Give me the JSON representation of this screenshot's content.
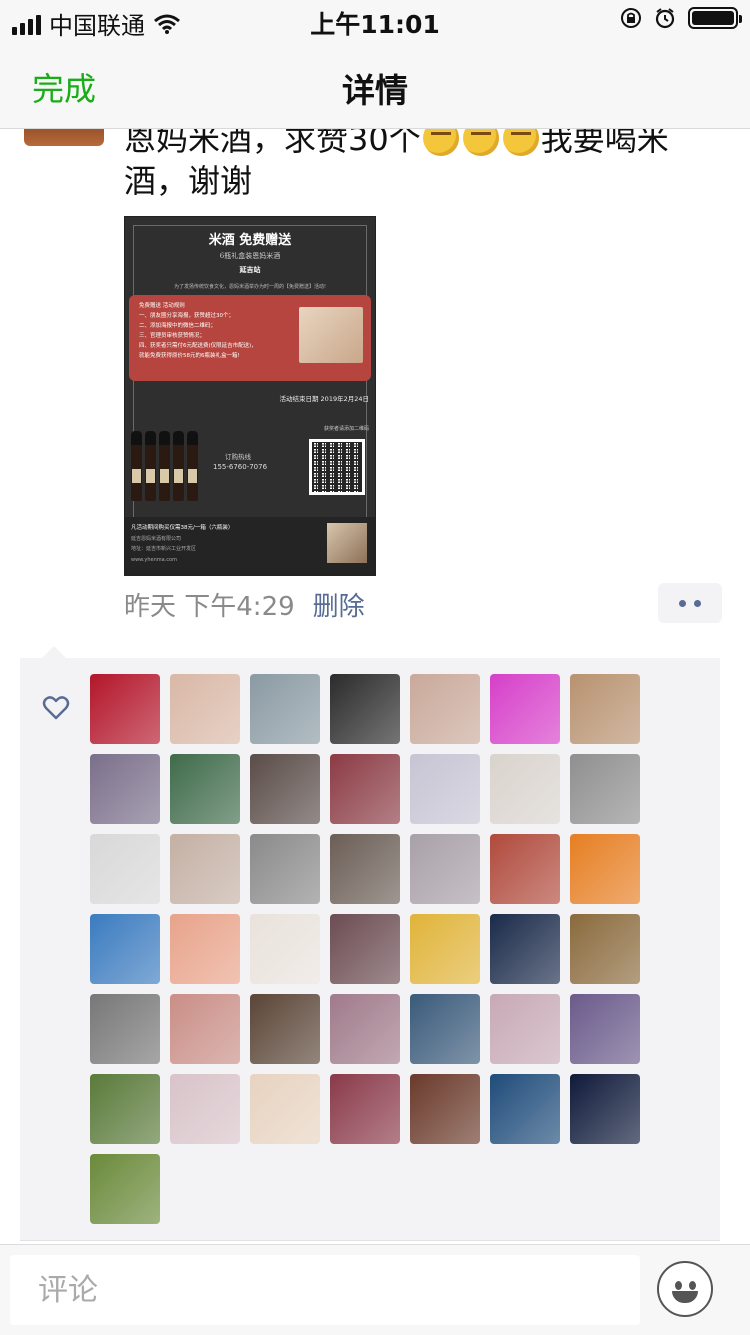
{
  "status_bar": {
    "carrier": "中国联通",
    "time": "上午11:01"
  },
  "navbar": {
    "done_label": "完成",
    "title": "详情"
  },
  "post": {
    "text_part1": "恩妈米酒，求赞30个",
    "text_part2": "我要喝米酒，谢谢",
    "emoji_count": 3,
    "time": "昨天 下午4:29",
    "delete_label": "删除"
  },
  "poster": {
    "title": "米酒 免费赠送",
    "subtitle": "6瓶礼盒装恩妈米酒",
    "location": "延吉站",
    "description": "为了发扬传统饮食文化，恩妈米酒举办为时一周的【免费赠送】活动!",
    "rules": "免费赠送 活动规则\n一、朋友圈分享海报，获赞超过30个；\n二、添加海报中的微信二维码；\n三、官理员审核获赞情况；\n四、获奖者只需付6元配送费(仅限延吉市配送)，\n    就能免费获得原价58元的6瓶装礼盒一箱!",
    "end_date": "活动结束日期 2019年2月24日",
    "phone_label": "订购热线",
    "phone": "155-6760-7076",
    "qr_label": "获奖者请添加二维码",
    "footer_main": "凡活动期间购买仅需38元/一箱（六瓶装）",
    "footer_company": "延吉恩妈米酒有限公司",
    "footer_address": "地址：延吉市新兴工业开发区",
    "footer_web": "www.yhenma.com"
  },
  "likes": {
    "avatars": [
      "#b3162a",
      "#d9b8a6",
      "#8a9aa3",
      "#2b2b2b",
      "#c9a99a",
      "#d63fc9",
      "#b89270",
      "#7a6f8a",
      "#3f6b4a",
      "#5a4c48",
      "#8b3b44",
      "#c7c4d4",
      "#d9d3cd",
      "#8f8f8f",
      "#d8d8d8",
      "#c4b0a4",
      "#8a8a8a",
      "#6b5e56",
      "#a8a0a8",
      "#b04a3c",
      "#e67e22",
      "#3b7bbf",
      "#e8a38a",
      "#e9e2dc",
      "#6b4c52",
      "#e0b43a",
      "#1a2a4a",
      "#8a6a3c",
      "#777777",
      "#c98e86",
      "#5a4536",
      "#a07a8a",
      "#3a5a7a",
      "#c7a9b5",
      "#6a5a8a",
      "#5a7a3a",
      "#d8c3c9",
      "#e7d3c0",
      "#8a3a4a",
      "#6a3a2a",
      "#1f4c7a",
      "#0f1a3a",
      "#6a8a3a"
    ]
  },
  "comment": {
    "placeholder": "评论"
  }
}
